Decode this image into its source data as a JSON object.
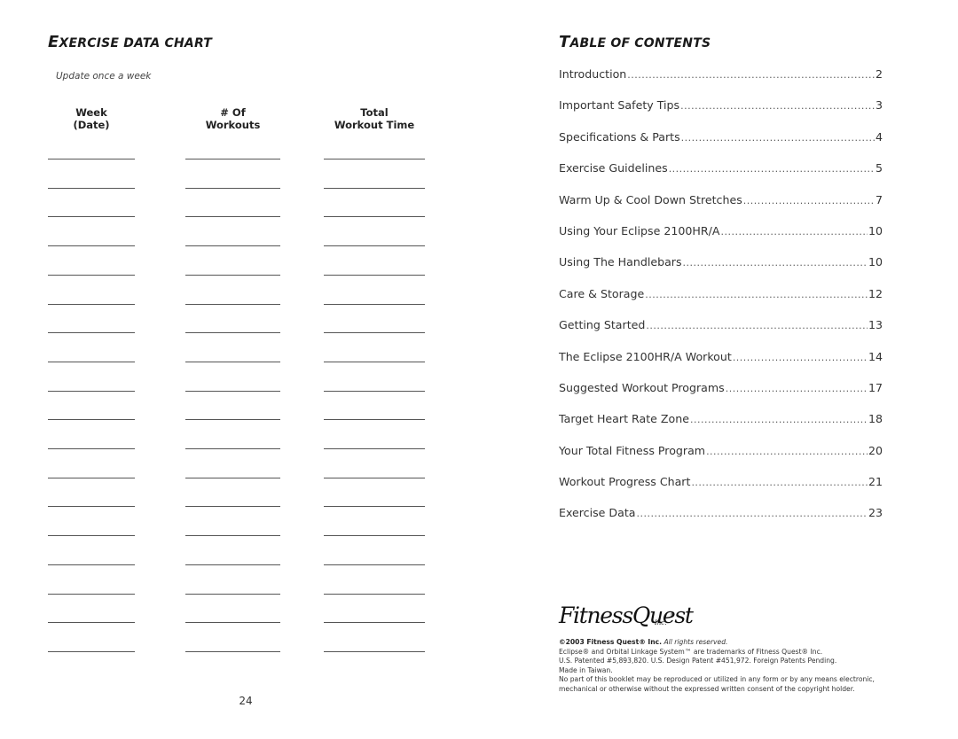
{
  "left_page": {
    "title_initial": "E",
    "title_rest": "XERCISE DATA CHART",
    "subtitle": "Update once a week",
    "columns": [
      {
        "line1": "Week",
        "line2": "(Date)"
      },
      {
        "line1": "# Of",
        "line2": "Workouts"
      },
      {
        "line1": "Total",
        "line2": "Workout Time"
      }
    ],
    "blank_rows": 18,
    "page_number": "24"
  },
  "right_page": {
    "title_initial": "T",
    "title_rest": "ABLE OF CONTENTS",
    "toc": [
      {
        "title": "Introduction",
        "page": "2"
      },
      {
        "title": "Important Safety Tips",
        "page": "3"
      },
      {
        "title": "Specifications & Parts",
        "page": "4"
      },
      {
        "title": "Exercise Guidelines",
        "page": "5"
      },
      {
        "title": "Warm Up & Cool Down Stretches",
        "page": "7"
      },
      {
        "title": "Using Your Eclipse 2100HR/A",
        "page": "10"
      },
      {
        "title": "Using The Handlebars",
        "page": "10"
      },
      {
        "title": "Care & Storage",
        "page": "12"
      },
      {
        "title": "Getting Started",
        "page": "13"
      },
      {
        "title": "The Eclipse 2100HR/A Workout",
        "page": "14"
      },
      {
        "title": "Suggested Workout Programs",
        "page": "17"
      },
      {
        "title": "Target Heart Rate Zone",
        "page": "18"
      },
      {
        "title": "Your Total Fitness Program",
        "page": "20"
      },
      {
        "title": "Workout Progress Chart",
        "page": "21"
      },
      {
        "title": "Exercise Data",
        "page": "23"
      }
    ],
    "logo": {
      "text": "FitnessQuest",
      "suffix": "Inc.",
      "mark": "®"
    },
    "legal": {
      "copyright_bold": "©2003 Fitness Quest® Inc.",
      "copyright_rest": " All rights reserved.",
      "trademark": "Eclipse® and Orbital Linkage System™ are trademarks of Fitness Quest® Inc.",
      "patents": "U.S. Patented #5,893,820. U.S. Design Patent #451,972. Foreign Patents Pending.",
      "origin": "Made in Taiwan.",
      "notice_1": "No part of this booklet may be reproduced or utilized in any form or by any means electronic,",
      "notice_2": "mechanical or otherwise without the expressed written consent of the copyright holder."
    }
  }
}
